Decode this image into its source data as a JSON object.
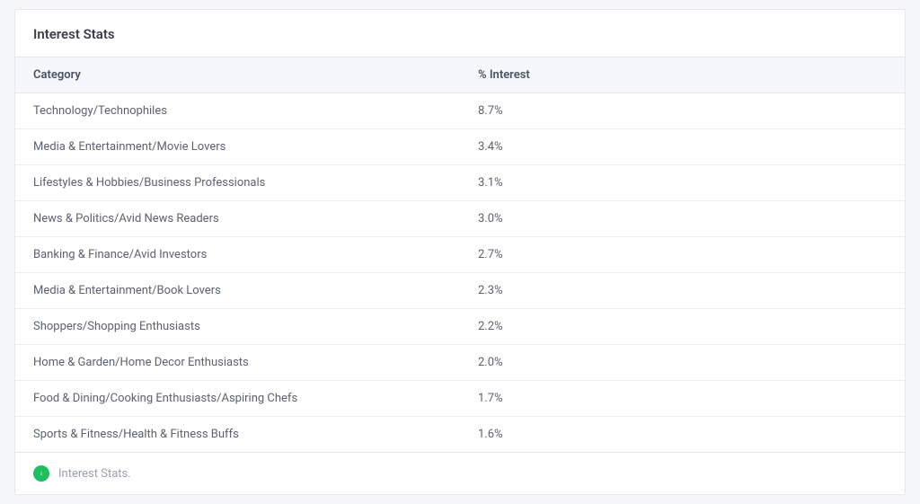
{
  "card": {
    "title": "Interest Stats",
    "footer_text": "Interest Stats."
  },
  "table": {
    "headers": {
      "category": "Category",
      "interest": "% Interest"
    },
    "rows": [
      {
        "category": "Technology/Technophiles",
        "interest": "8.7%"
      },
      {
        "category": "Media & Entertainment/Movie Lovers",
        "interest": "3.4%"
      },
      {
        "category": "Lifestyles & Hobbies/Business Professionals",
        "interest": "3.1%"
      },
      {
        "category": "News & Politics/Avid News Readers",
        "interest": "3.0%"
      },
      {
        "category": "Banking & Finance/Avid Investors",
        "interest": "2.7%"
      },
      {
        "category": "Media & Entertainment/Book Lovers",
        "interest": "2.3%"
      },
      {
        "category": "Shoppers/Shopping Enthusiasts",
        "interest": "2.2%"
      },
      {
        "category": "Home & Garden/Home Decor Enthusiasts",
        "interest": "2.0%"
      },
      {
        "category": "Food & Dining/Cooking Enthusiasts/Aspiring Chefs",
        "interest": "1.7%"
      },
      {
        "category": "Sports & Fitness/Health & Fitness Buffs",
        "interest": "1.6%"
      }
    ]
  }
}
